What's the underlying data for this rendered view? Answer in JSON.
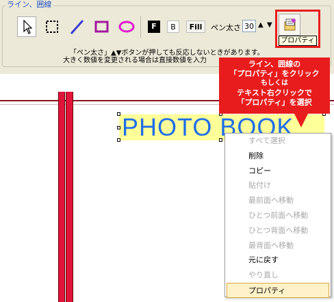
{
  "toolbar": {
    "group_title": "ライン、囲線",
    "tools": [
      {
        "name": "select-arrow-icon",
        "selected": true
      },
      {
        "name": "marquee-select-icon",
        "selected": false
      },
      {
        "name": "line-tool-icon",
        "selected": false
      },
      {
        "name": "rectangle-tool-icon",
        "selected": false
      },
      {
        "name": "ellipse-tool-icon",
        "selected": false
      }
    ],
    "f_label": "F",
    "b_label": "B",
    "fill_label": "Fill",
    "pen_label": "ペン太さ",
    "pen_value": "30",
    "pen_up": "▲",
    "pen_down": "▼",
    "properties_tooltip": "プロパティ",
    "notice_line1": "「ペン太さ」▲▼ボタンが押しても反応しないときがあります。",
    "notice_line2": "大きく数値を変更される場合は直接数値を入力"
  },
  "callout": {
    "line1": "ライン、囲線の",
    "line2": "「プロパティ」をクリック",
    "line3": "もしくは",
    "line4": "テキスト右クリックで",
    "line5": "「プロパティ」を選択"
  },
  "canvas": {
    "text_content": "PHOTO BOOK"
  },
  "context_menu": {
    "items": [
      {
        "label": "すべて選択",
        "enabled": false
      },
      {
        "label": "削除",
        "enabled": true
      },
      {
        "label": "コピー",
        "enabled": true
      },
      {
        "label": "貼付け",
        "enabled": false
      },
      {
        "label": "最前面へ移動",
        "enabled": false
      },
      {
        "label": "ひとつ前面へ移動",
        "enabled": false
      },
      {
        "label": "ひとつ背面へ移動",
        "enabled": false
      },
      {
        "label": "最背面へ移動",
        "enabled": false
      },
      {
        "label": "元に戻す",
        "enabled": true
      },
      {
        "label": "やり直し",
        "enabled": false
      },
      {
        "label": "プロパティ",
        "enabled": true,
        "highlighted": true
      }
    ]
  },
  "colors": {
    "callout_red": "#e81c1c",
    "text_blue": "#1e6ee8",
    "textbox_yellow": "#ffff99",
    "bar_red": "#e0143a"
  }
}
